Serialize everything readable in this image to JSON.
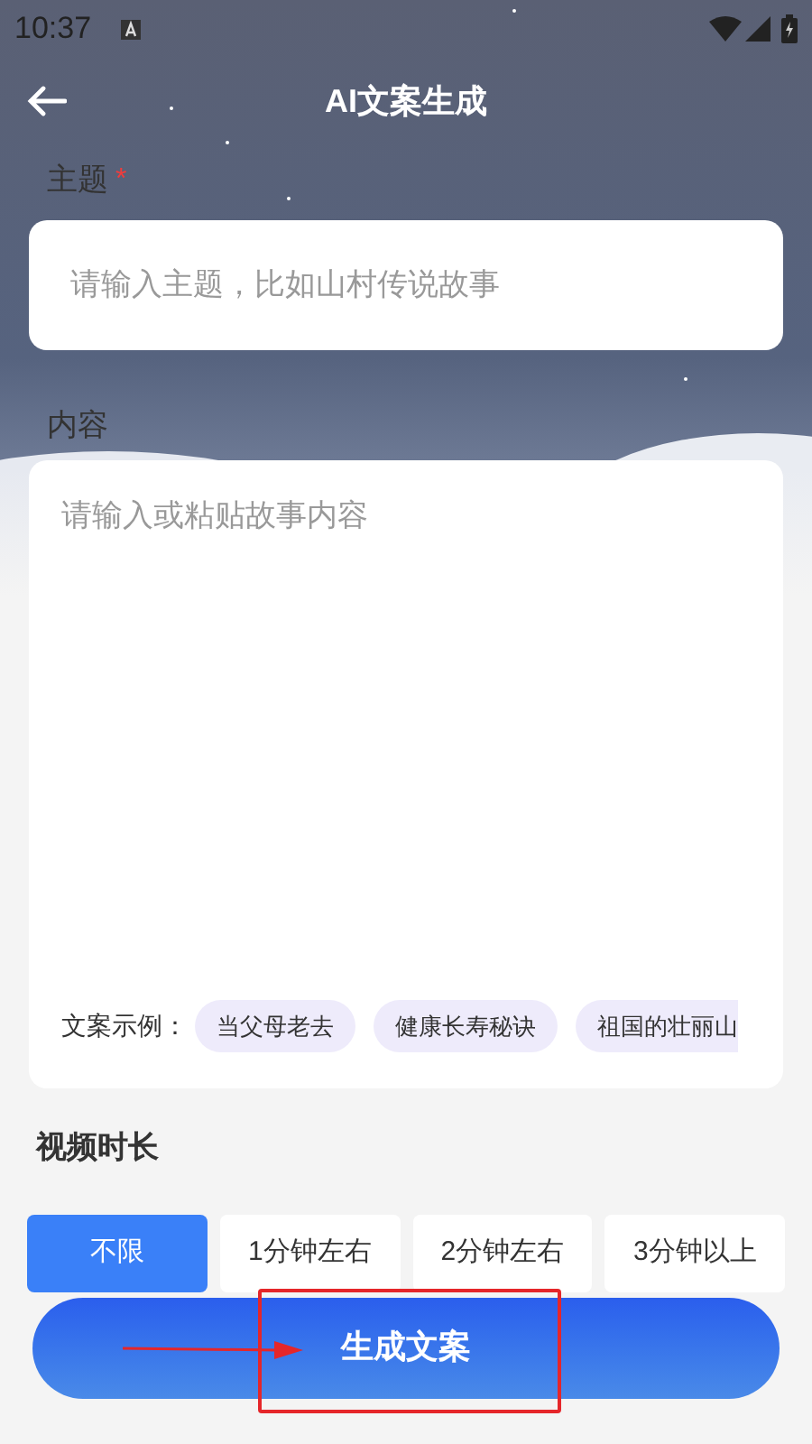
{
  "status_bar": {
    "time": "10:37"
  },
  "header": {
    "title": "AI文案生成"
  },
  "topic": {
    "label": "主题",
    "required_mark": "*",
    "placeholder": "请输入主题，比如山村传说故事"
  },
  "content": {
    "label": "内容",
    "placeholder": "请输入或粘贴故事内容",
    "examples_label": "文案示例：",
    "examples": [
      "当父母老去",
      "健康长寿秘诀",
      "祖国的壮丽山"
    ]
  },
  "duration": {
    "label": "视频时长",
    "options": [
      {
        "label": "不限",
        "selected": true
      },
      {
        "label": "1分钟左右",
        "selected": false
      },
      {
        "label": "2分钟左右",
        "selected": false
      },
      {
        "label": "3分钟以上",
        "selected": false
      }
    ]
  },
  "generate_button": {
    "label": "生成文案"
  }
}
